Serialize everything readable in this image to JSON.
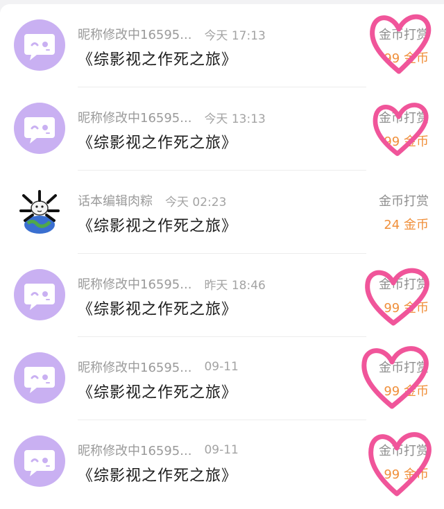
{
  "rows": [
    {
      "user": "昵称修改中16595...",
      "time": "今天 17:13",
      "title": "《综影视之作死之旅》",
      "label": "金币打赏",
      "amount": "99 金币",
      "avatar": "chat-bubble-face-icon"
    },
    {
      "user": "昵称修改中16595...",
      "time": "今天 13:13",
      "title": "《综影视之作死之旅》",
      "label": "金币打赏",
      "amount": "99 金币",
      "avatar": "chat-bubble-face-icon"
    },
    {
      "user": "话本编辑肉粽",
      "time": "今天 02:23",
      "title": "《综影视之作死之旅》",
      "label": "金币打赏",
      "amount": "24 金币",
      "avatar": "earth-creature-avatar"
    },
    {
      "user": "昵称修改中16595...",
      "time": "昨天 18:46",
      "title": "《综影视之作死之旅》",
      "label": "金币打赏",
      "amount": "99 金币",
      "avatar": "chat-bubble-face-icon"
    },
    {
      "user": "昵称修改中16595...",
      "time": "09-11",
      "title": "《综影视之作死之旅》",
      "label": "金币打赏",
      "amount": "99 金币",
      "avatar": "chat-bubble-face-icon"
    },
    {
      "user": "昵称修改中16595...",
      "time": "09-11",
      "title": "《综影视之作死之旅》",
      "label": "金币打赏",
      "amount": "99 金币",
      "avatar": "chat-bubble-face-icon"
    }
  ],
  "colors": {
    "avatar_bg": "#c9b0f2",
    "amount": "#f08f3a",
    "heart_annotation": "#f0559a"
  }
}
